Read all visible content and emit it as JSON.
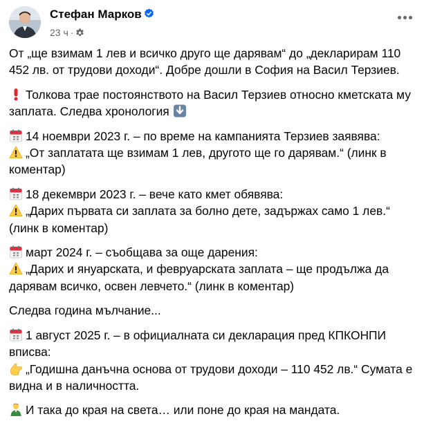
{
  "post": {
    "author": "Стефан Марков",
    "time": "23 ч",
    "paragraphs": [
      {
        "lines": [
          {
            "icon": "",
            "text": "От „ще взимам 1 лев и всичко друго ще дарявам“ до „декларирам 110 452 лв. от трудови доходи“. Добре дошли в София на Васил Терзиев."
          }
        ]
      },
      {
        "lines": [
          {
            "icon": "exclamation-icon",
            "text": "Толкова трае постоянството на Васил Терзиев относно кметската му заплата. Следва хронология",
            "trail_icon": "down-arrow-icon"
          }
        ]
      },
      {
        "lines": [
          {
            "icon": "calendar-icon",
            "text": "14 ноември 2023 г. – по време на кампанията Терзиев заявява:"
          },
          {
            "icon": "warning-icon",
            "text": "„От заплатата ще взимам 1 лев, другото ще го дарявам.“ (линк в коментар)"
          }
        ]
      },
      {
        "lines": [
          {
            "icon": "calendar-icon",
            "text": "18 декември 2023 г. – вече като кмет обявява:"
          },
          {
            "icon": "warning-icon",
            "text": "„Дарих първата си заплата за болно дете, задържах само 1 лев.“ (линк в коментар)"
          }
        ]
      },
      {
        "lines": [
          {
            "icon": "calendar-icon",
            "text": "март 2024 г. – съобщава за още дарения:"
          },
          {
            "icon": "warning-icon",
            "text": "„Дарих и януарската, и февруарската заплата – ще продължа да дарявам всичко, освен левчето.“ (линк в коментар)"
          }
        ]
      },
      {
        "lines": [
          {
            "icon": "",
            "text": "Следва година мълчание..."
          }
        ]
      },
      {
        "lines": [
          {
            "icon": "calendar-icon",
            "text": "1 август 2025 г. – в официалната си декларация пред КПКОНПИ вписва:"
          },
          {
            "icon": "pointing-hand-icon",
            "text": "„Годишна данъчна основа от трудови доходи – 110 452 лв.“ Сумата е видна и в наличността."
          }
        ]
      },
      {
        "lines": [
          {
            "icon": "person-icon",
            "text": "И така до края на света… или поне до края на мандата."
          }
        ]
      }
    ]
  },
  "colors": {
    "text": "#050505",
    "meta": "#65676b",
    "verified": "#0866ff"
  }
}
